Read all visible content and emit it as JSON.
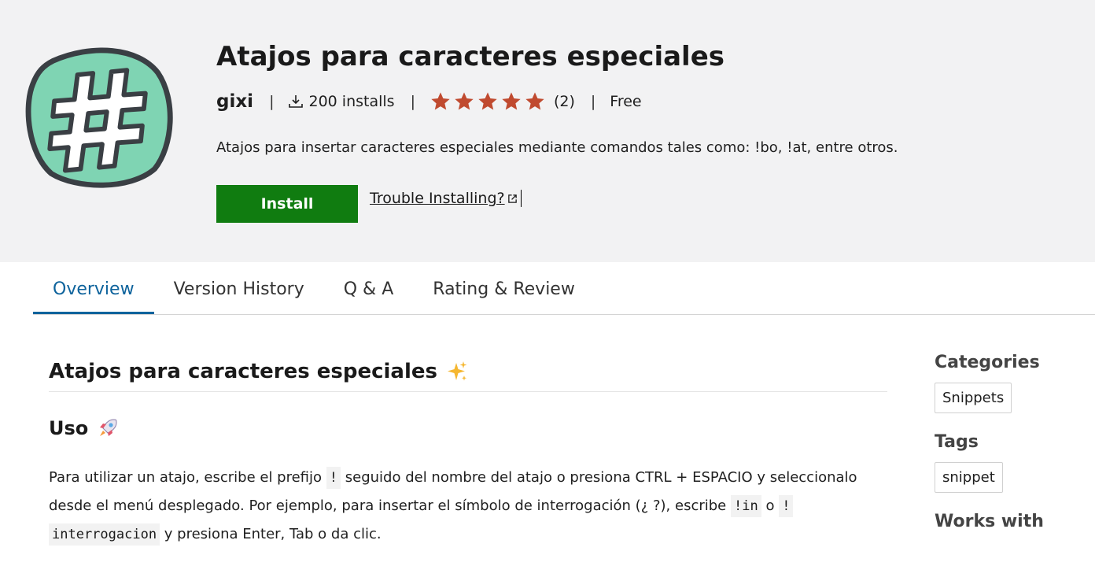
{
  "extension": {
    "title": "Atajos para caracteres especiales",
    "publisher": "gixi",
    "installs": "200 installs",
    "rating_stars": 5,
    "rating_count": "(2)",
    "price": "Free",
    "separator": "|",
    "description": "Atajos para insertar caracteres especiales mediante comandos tales como: !bo, !at, entre otros.",
    "install_label": "Install",
    "trouble_label": "Trouble Installing?"
  },
  "colors": {
    "install_button": "#107c10",
    "star": "#c04a2f",
    "tab_active": "#0e639c",
    "logo_fill": "#7fd4b3"
  },
  "icons": {
    "logo": "hash-logo-icon",
    "installs": "download-icon",
    "rating": "star-icon",
    "trouble": "external-link-icon"
  },
  "tabs": [
    {
      "label": "Overview",
      "active": true
    },
    {
      "label": "Version History",
      "active": false
    },
    {
      "label": "Q & A",
      "active": false
    },
    {
      "label": "Rating & Review",
      "active": false
    }
  ],
  "readme": {
    "heading": "Atajos para caracteres especiales",
    "heading_emoji": "sparkles",
    "section_heading": "Uso",
    "section_emoji": "rocket",
    "para_1": "Para utilizar un atajo, escribe el prefijo",
    "code_1": "!",
    "para_2": "seguido del nombre del atajo o presiona CTRL + ESPACIO y seleccionalo desde el menú desplegado. Por ejemplo, para insertar el símbolo de interrogación (¿ ?), escribe",
    "code_2": "!in",
    "para_3": "o",
    "code_3": "!",
    "code_4": "interrogacion",
    "para_4": "y presiona Enter, Tab o da clic."
  },
  "sidebar": {
    "categories_heading": "Categories",
    "categories": [
      "Snippets"
    ],
    "tags_heading": "Tags",
    "tags": [
      "snippet"
    ],
    "works_with_heading": "Works with"
  }
}
